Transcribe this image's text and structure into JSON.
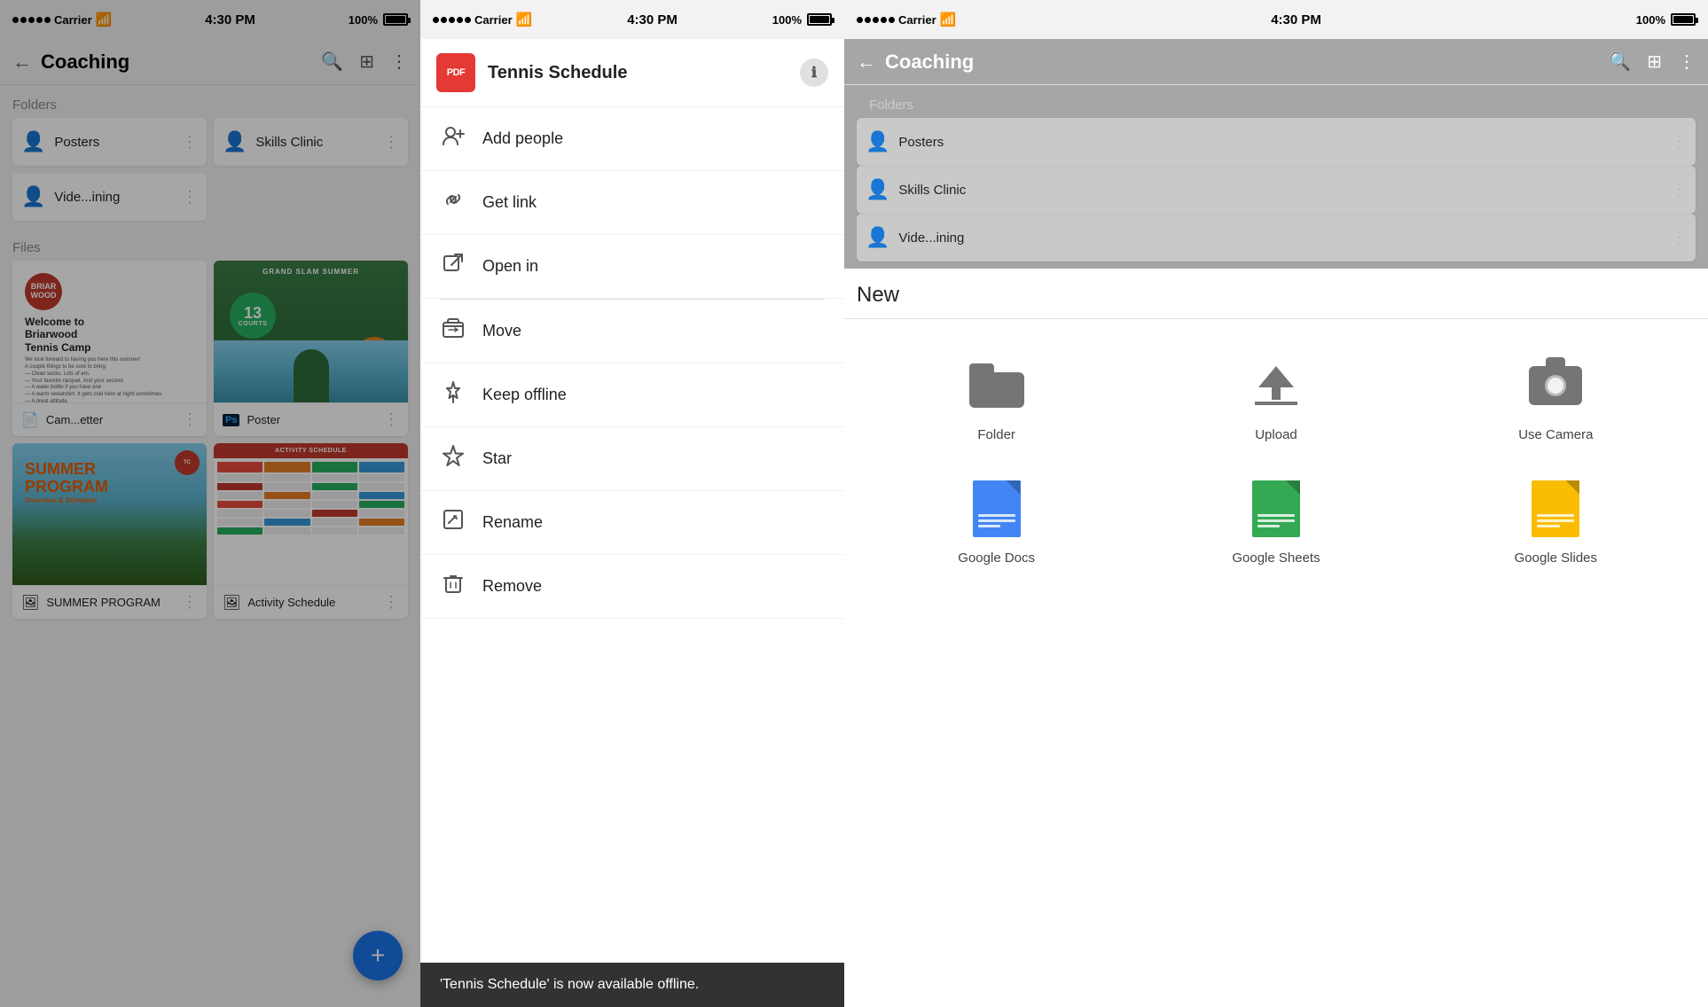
{
  "panel1": {
    "status": {
      "carrier": "Carrier",
      "wifi": true,
      "time": "4:30 PM",
      "battery": "100%"
    },
    "nav": {
      "title": "Coaching",
      "back": "←"
    },
    "folders_label": "Folders",
    "folders": [
      {
        "name": "Posters",
        "icon": "folder-person"
      },
      {
        "name": "Skills Clinic",
        "icon": "folder-person"
      },
      {
        "name": "Vide...ining",
        "icon": "folder-person"
      }
    ],
    "files_label": "Files",
    "files": [
      {
        "name": "Cam...etter",
        "type": "docs",
        "type_label": "Docs",
        "thumb": "welcome"
      },
      {
        "name": "Poster",
        "type": "photoshop",
        "type_label": "Ps",
        "thumb": "poster"
      },
      {
        "name": "SUMMER PROGRAM Overview & Schedule",
        "type": "image",
        "thumb": "summer"
      },
      {
        "name": "Activity Schedule",
        "type": "image",
        "thumb": "schedule"
      }
    ],
    "fab_label": "+"
  },
  "panel2": {
    "status": {
      "carrier": "Carrier",
      "wifi": true,
      "time": "4:30 PM",
      "battery": "100%"
    },
    "file_name": "Tennis Schedule",
    "file_type": "PDF",
    "info_btn": "ℹ",
    "menu_items": [
      {
        "icon": "add-person",
        "label": "Add people"
      },
      {
        "icon": "link",
        "label": "Get link"
      },
      {
        "icon": "open-in",
        "label": "Open in"
      },
      {
        "icon": "move",
        "label": "Move"
      },
      {
        "icon": "pin",
        "label": "Keep offline"
      },
      {
        "icon": "star",
        "label": "Star"
      },
      {
        "icon": "rename",
        "label": "Rename"
      },
      {
        "icon": "trash",
        "label": "Remove"
      }
    ],
    "toast": "'Tennis Schedule' is now available offline."
  },
  "panel3": {
    "status": {
      "carrier": "Carrier",
      "wifi": true,
      "time": "4:30 PM",
      "battery": "100%"
    },
    "nav": {
      "title": "Coaching"
    },
    "folders_label": "Folders",
    "folders": [
      {
        "name": "Posters"
      },
      {
        "name": "Skills Clinic"
      },
      {
        "name": "Vide...ining"
      }
    ],
    "new_title": "New",
    "new_items": [
      {
        "icon": "folder",
        "label": "Folder"
      },
      {
        "icon": "upload",
        "label": "Upload"
      },
      {
        "icon": "camera",
        "label": "Use Camera"
      },
      {
        "icon": "google-docs",
        "label": "Google Docs"
      },
      {
        "icon": "google-sheets",
        "label": "Google Sheets"
      },
      {
        "icon": "google-slides",
        "label": "Google Slides"
      }
    ]
  }
}
